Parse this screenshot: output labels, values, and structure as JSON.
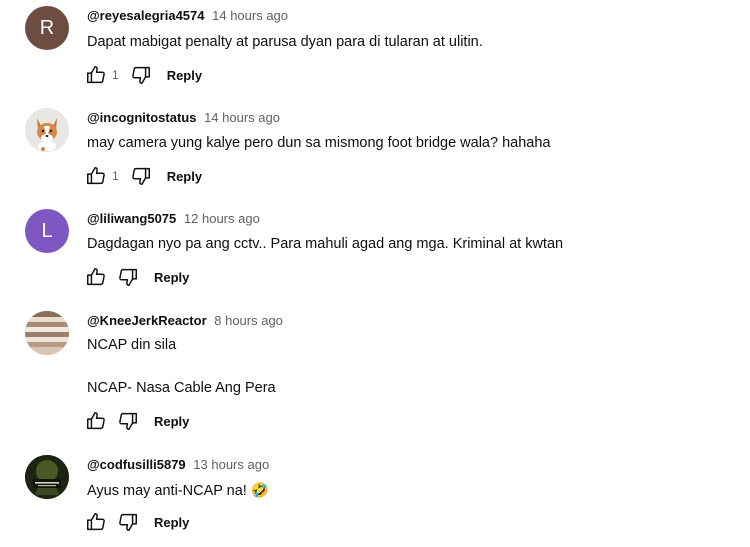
{
  "comments": [
    {
      "handle": "@reyesalegria4574",
      "time": "14 hours ago",
      "avatar_letter": "R",
      "avatar_color": "#6d4c41",
      "text": "Dapat mabigat penalty at parusa dyan para di tularan at ulitin.",
      "like_count": "1",
      "reply_label": "Reply"
    },
    {
      "handle": "@incognitostatus",
      "time": "14 hours ago",
      "avatar_letter": "",
      "avatar_color": "#e8e6e3",
      "text": "may camera yung kalye pero dun sa mismong foot bridge wala? hahaha",
      "like_count": "1",
      "reply_label": "Reply"
    },
    {
      "handle": "@liliwang5075",
      "time": "12 hours ago",
      "avatar_letter": "L",
      "avatar_color": "#7e57c2",
      "text": "Dagdagan nyo pa ang cctv.. Para mahuli agad ang mga. Kriminal at kwtan",
      "like_count": "",
      "reply_label": "Reply"
    },
    {
      "handle": "@KneeJerkReactor",
      "time": "8 hours ago",
      "avatar_letter": "",
      "avatar_color": "#b79c86",
      "text": "NCAP din sila",
      "text2": "NCAP- Nasa Cable Ang Pera",
      "like_count": "",
      "reply_label": "Reply"
    },
    {
      "handle": "@codfusilli5879",
      "time": "13 hours ago",
      "avatar_letter": "",
      "avatar_color": "#2f3a1c",
      "text": "Ayus may anti-NCAP na! 🤣",
      "like_count": "",
      "reply_label": "Reply"
    }
  ]
}
